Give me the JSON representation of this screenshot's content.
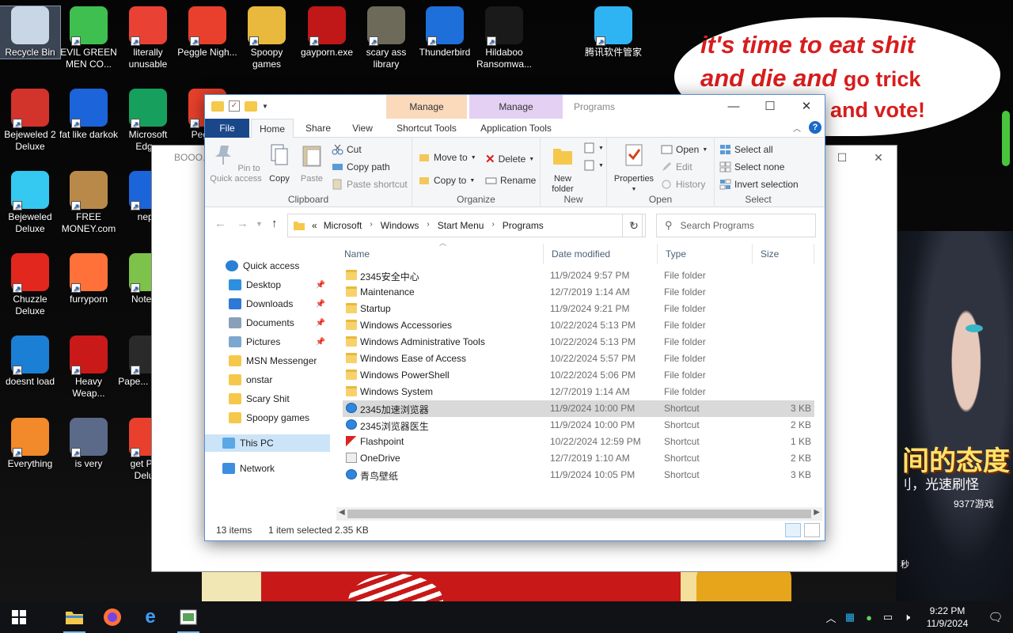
{
  "desktop": {
    "bubble_text": [
      "it's time to eat shit",
      "and die and",
      "go trick",
      "and vote!"
    ],
    "ad_text": "间的态度",
    "ad_sub": "刂，光速刷怪",
    "ad_brand": "9377游戏",
    "ad_seconds": "秒",
    "icons": [
      {
        "name": "recycle-bin",
        "label": "Recycle Bin",
        "icon": "recycle-bin-icon",
        "color": "#c8d6e5"
      },
      {
        "name": "evil-green-men",
        "label": "EVIL GREEN MEN CO...",
        "icon": "msn-icon",
        "color": "#3fbf4f"
      },
      {
        "name": "literally-unusable",
        "label": "literally unusable",
        "icon": "chrome-icon",
        "color": "#e94235"
      },
      {
        "name": "peggle-nights",
        "label": "Peggle Nigh...",
        "icon": "peggle-icon",
        "color": "#e8402c"
      },
      {
        "name": "spoopy-games",
        "label": "Spoopy games",
        "icon": "folder-icon",
        "color": "#e8b93d"
      },
      {
        "name": "gayporn-exe",
        "label": "gayporn.exe",
        "icon": "flash-icon",
        "color": "#c01818"
      },
      {
        "name": "scary-ass-library",
        "label": "scary ass library",
        "icon": "library-icon",
        "color": "#6d6a5a"
      },
      {
        "name": "thunderbird",
        "label": "Thunderbird",
        "icon": "thunderbird-icon",
        "color": "#1e6fd9"
      },
      {
        "name": "hildaboo-ransomware",
        "label": "Hildaboo Ransomwa...",
        "icon": "shield-icon",
        "color": "#1a1a1a"
      },
      {
        "name": "tencent-manager",
        "label": "腾讯软件管家",
        "icon": "tencent-icon",
        "color": "#2fb4f3"
      },
      {
        "name": "bejeweled-2",
        "label": "Bejeweled 2 Deluxe",
        "icon": "bejeweled2-icon",
        "color": "#d2332b"
      },
      {
        "name": "fat-like-darkok",
        "label": "fat like darkok",
        "icon": "mpl-icon",
        "color": "#1c64d9"
      },
      {
        "name": "microsoft-edge",
        "label": "Microsoft Edg...",
        "icon": "edge-icon",
        "color": "#17a05d"
      },
      {
        "name": "peggle",
        "label": "Peggl...",
        "icon": "peggle-icon",
        "color": "#e8402c"
      },
      {
        "name": "bejeweled-deluxe",
        "label": "Bejeweled Deluxe",
        "icon": "diamond-icon",
        "color": "#35c8f0"
      },
      {
        "name": "free-money",
        "label": "FREE MONEY.com",
        "icon": "money-bag-icon",
        "color": "#b9894a"
      },
      {
        "name": "neph",
        "label": "neph",
        "icon": "mpl-icon",
        "color": "#1c64d9"
      },
      {
        "name": "chuzzle-deluxe",
        "label": "Chuzzle Deluxe",
        "icon": "chuzzle-icon",
        "color": "#e2271f"
      },
      {
        "name": "furryporn",
        "label": "furryporn",
        "icon": "firefox-icon",
        "color": "#ff7139"
      },
      {
        "name": "notepad",
        "label": "Notep...",
        "icon": "notepad-icon",
        "color": "#7dc24a"
      },
      {
        "name": "doesnt-load",
        "label": "doesnt load",
        "icon": "ie-icon",
        "color": "#1b7fd6"
      },
      {
        "name": "heavy-weapon",
        "label": "Heavy Weap...",
        "icon": "radiation-icon",
        "color": "#c91919"
      },
      {
        "name": "paper-please",
        "label": "Pape... Plea...",
        "icon": "paper-icon",
        "color": "#2a2a2a"
      },
      {
        "name": "everything",
        "label": "Everything",
        "icon": "search-ring-icon",
        "color": "#f2892a"
      },
      {
        "name": "is-very",
        "label": "is very",
        "icon": "mpl-shield-icon",
        "color": "#5a6a88"
      },
      {
        "name": "get-peggle-deluxe",
        "label": "get Pe... Delu...",
        "icon": "peggle-icon",
        "color": "#e8402c"
      }
    ]
  },
  "back_window": {
    "title": "BOOO..."
  },
  "explorer": {
    "title": "Programs",
    "context_tabs": {
      "manage1": "Manage",
      "manage2": "Manage"
    },
    "tabs": {
      "file": "File",
      "home": "Home",
      "share": "Share",
      "view": "View",
      "shortcut_tools": "Shortcut Tools",
      "application_tools": "Application Tools"
    },
    "ribbon": {
      "pin": "Pin to Quick access",
      "copy": "Copy",
      "paste": "Paste",
      "cut": "Cut",
      "copy_path": "Copy path",
      "paste_shortcut": "Paste shortcut",
      "clipboard": "Clipboard",
      "move_to": "Move to",
      "copy_to": "Copy to",
      "delete": "Delete",
      "rename": "Rename",
      "organize": "Organize",
      "new_folder": "New folder",
      "new": "New",
      "properties": "Properties",
      "open": "Open",
      "edit": "Edit",
      "history": "History",
      "open_group": "Open",
      "select_all": "Select all",
      "select_none": "Select none",
      "invert_selection": "Invert selection",
      "select": "Select"
    },
    "address": {
      "prefix": "«",
      "crumbs": [
        "Microsoft",
        "Windows",
        "Start Menu",
        "Programs"
      ]
    },
    "search_placeholder": "Search Programs",
    "nav": [
      {
        "label": "Quick access",
        "icon": "star-icon",
        "pinned": false
      },
      {
        "label": "Desktop",
        "icon": "desktop-icon",
        "pinned": true
      },
      {
        "label": "Downloads",
        "icon": "download-icon",
        "pinned": true
      },
      {
        "label": "Documents",
        "icon": "documents-icon",
        "pinned": true
      },
      {
        "label": "Pictures",
        "icon": "pictures-icon",
        "pinned": true
      },
      {
        "label": "MSN Messenger",
        "icon": "folder-icon",
        "pinned": false
      },
      {
        "label": "onstar",
        "icon": "folder-icon",
        "pinned": false
      },
      {
        "label": "Scary Shit",
        "icon": "folder-icon",
        "pinned": false
      },
      {
        "label": "Spoopy games",
        "icon": "folder-icon",
        "pinned": false
      },
      {
        "label": "This PC",
        "icon": "pc-icon",
        "pinned": false
      },
      {
        "label": "Network",
        "icon": "network-icon",
        "pinned": false
      }
    ],
    "columns": {
      "name": "Name",
      "date": "Date modified",
      "type": "Type",
      "size": "Size"
    },
    "files": [
      {
        "name": "2345安全中心",
        "date": "11/9/2024 9:57 PM",
        "type": "File folder",
        "size": "",
        "icon": "folder"
      },
      {
        "name": "Maintenance",
        "date": "12/7/2019 1:14 AM",
        "type": "File folder",
        "size": "",
        "icon": "folder"
      },
      {
        "name": "Startup",
        "date": "11/9/2024 9:21 PM",
        "type": "File folder",
        "size": "",
        "icon": "folder"
      },
      {
        "name": "Windows Accessories",
        "date": "10/22/2024 5:13 PM",
        "type": "File folder",
        "size": "",
        "icon": "folder"
      },
      {
        "name": "Windows Administrative Tools",
        "date": "10/22/2024 5:13 PM",
        "type": "File folder",
        "size": "",
        "icon": "folder"
      },
      {
        "name": "Windows Ease of Access",
        "date": "10/22/2024 5:57 PM",
        "type": "File folder",
        "size": "",
        "icon": "folder"
      },
      {
        "name": "Windows PowerShell",
        "date": "10/22/2024 5:06 PM",
        "type": "File folder",
        "size": "",
        "icon": "folder"
      },
      {
        "name": "Windows System",
        "date": "12/7/2019 1:14 AM",
        "type": "File folder",
        "size": "",
        "icon": "folder"
      },
      {
        "name": "2345加速浏览器",
        "date": "11/9/2024 10:00 PM",
        "type": "Shortcut",
        "size": "3 KB",
        "icon": "shortcut",
        "selected": true
      },
      {
        "name": "2345浏览器医生",
        "date": "11/9/2024 10:00 PM",
        "type": "Shortcut",
        "size": "2 KB",
        "icon": "shortcut"
      },
      {
        "name": "Flashpoint",
        "date": "10/22/2024 12:59 PM",
        "type": "Shortcut",
        "size": "1 KB",
        "icon": "flash"
      },
      {
        "name": "OneDrive",
        "date": "12/7/2019 1:10 AM",
        "type": "Shortcut",
        "size": "2 KB",
        "icon": "onedrive"
      },
      {
        "name": "青鸟壁纸",
        "date": "11/9/2024 10:05 PM",
        "type": "Shortcut",
        "size": "3 KB",
        "icon": "shortcut"
      }
    ],
    "status": {
      "items": "13 items",
      "selected": "1 item selected",
      "size": "2.35 KB"
    }
  },
  "taskbar": {
    "icons": [
      "windows-start-icon",
      "file-explorer-icon",
      "firefox-icon",
      "ie-icon",
      "app-icon"
    ],
    "time": "9:22 PM",
    "date": "11/9/2024"
  }
}
